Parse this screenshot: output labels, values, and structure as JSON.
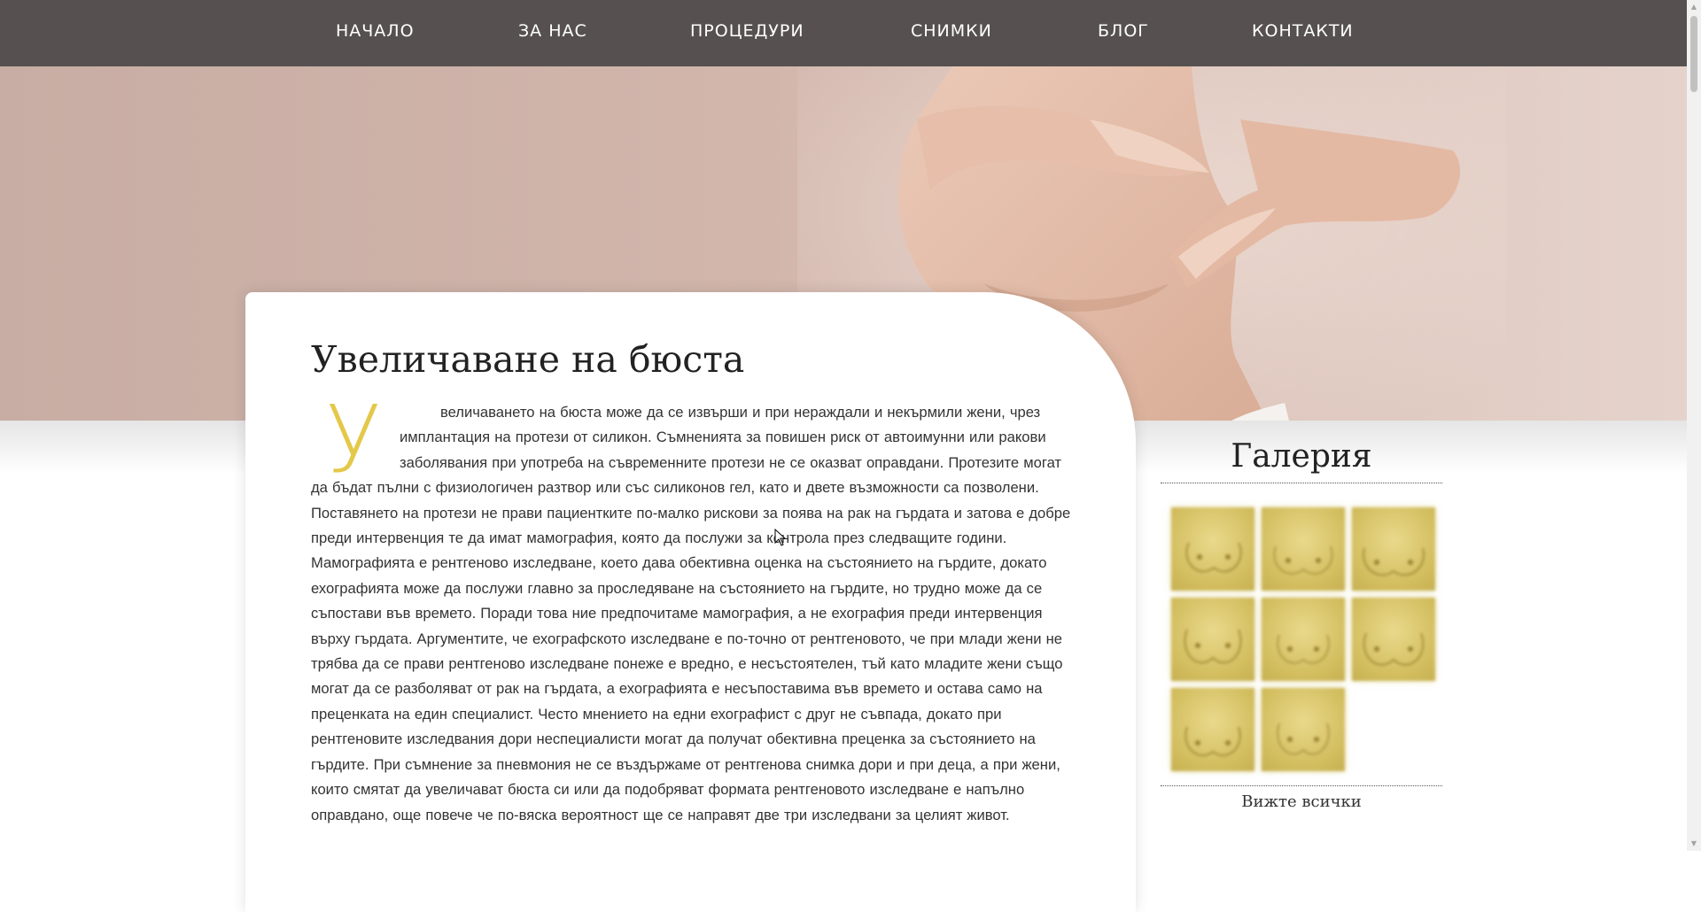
{
  "nav": {
    "items": [
      {
        "label": "НАЧАЛО"
      },
      {
        "label": "ЗА НАС"
      },
      {
        "label": "ПРОЦЕДУРИ"
      },
      {
        "label": "СНИМКИ"
      },
      {
        "label": "БЛОГ"
      },
      {
        "label": "КОНТАКТИ"
      }
    ]
  },
  "article": {
    "title": "Увеличаване на бюста",
    "dropcap": "У",
    "body": "величаването на бюста може да се извърши и при нераждали и некърмили жени, чрез имплантация на протези от силикон. Съмненията за повишен риск от автоимунни или ракови заболявания при употреба на съвременните протези не се оказват оправдани. Протезите могат да бъдат пълни с физиологичен разтвор или със силиконов гел, като и двете възможности са позволени. Поставянето на протези не прави пациентките по-малко рискови за поява на рак на гърдата и затова е добре преди интервенция те да имат мамография, която да послужи за контрола през следващите години. Мамографията е рентгеново изследване, което дава обективна оценка на състоянието на гърдите, докато ехографията може да послужи главно за проследяване на състоянието на гърдите, но трудно може да се съпостави във времето. Поради това ние предпочитаме мамография, а не ехография преди интервенция върху гърдата. Аргументите, че ехографското изследване е по-точно от рентгеновото, че при млади жени не трябва да се прави рентгеново изследване понеже е вредно, е несъстоятелен, тъй като младите жени също могат да се разболяват от рак на гърдата, а ехографията е несъпоставима във времето и остава само на преценката на един специалист. Често мнението на едни ехографист с друг не съвпада, докато при рентгеновите изследвания дори неспециалисти могат да получат обективна преценка за състоянието на гърдите. При съмнение за пневмония не се въздържаме от рентгенова снимка дори и при деца, а при жени, които смятат да увеличават бюста си или да подобряват формата рентгеновото изследване е напълно оправдано, още повече че по-вяска вероятност ще се направят две три изследвани за целият живот."
  },
  "gallery": {
    "title": "Галерия",
    "see_all": "Вижте всички",
    "thumbnail_count": 8
  },
  "colors": {
    "nav_bg": "#565150",
    "dropcap": "#e4c84a",
    "hero_bg": "#d2b6ac",
    "thumb_tint": "#d9c46a"
  }
}
